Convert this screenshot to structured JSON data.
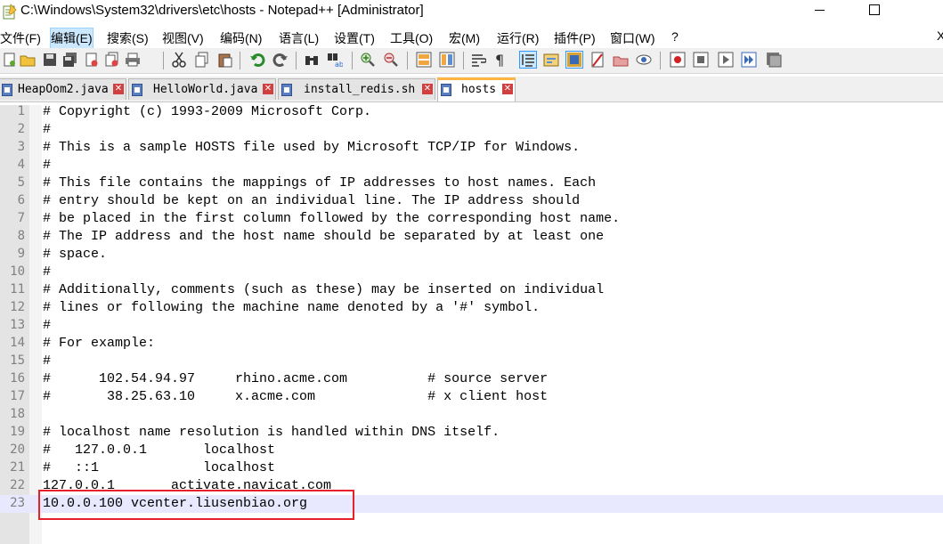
{
  "window": {
    "title": "C:\\Windows\\System32\\drivers\\etc\\hosts - Notepad++ [Administrator]"
  },
  "menu": [
    {
      "label": "文件(F)"
    },
    {
      "label": "编辑(E)",
      "active": true
    },
    {
      "label": "搜索(S)"
    },
    {
      "label": "视图(V)"
    },
    {
      "label": "编码(N)"
    },
    {
      "label": "语言(L)"
    },
    {
      "label": "设置(T)"
    },
    {
      "label": "工具(O)"
    },
    {
      "label": "宏(M)"
    },
    {
      "label": "运行(R)"
    },
    {
      "label": "插件(P)"
    },
    {
      "label": "窗口(W)"
    },
    {
      "label": "?"
    }
  ],
  "menu_close": "X",
  "toolbar_icons": [
    "new-file-icon",
    "open-file-icon",
    "save-icon",
    "save-all-icon",
    "close-icon",
    "close-all-icon",
    "print-icon",
    "cut-icon",
    "copy-icon",
    "paste-icon",
    "undo-icon",
    "redo-icon",
    "find-icon",
    "replace-icon",
    "zoom-in-icon",
    "zoom-out-icon",
    "sync-vertical-icon",
    "sync-horizontal-icon",
    "word-wrap-icon",
    "show-all-chars-icon",
    "indent-guide-icon",
    "user-language-icon",
    "function-list-icon",
    "folder-workspace-icon",
    "document-map-icon",
    "monitor-icon",
    "record-macro-icon",
    "stop-record-icon",
    "playback-macro-icon",
    "run-macro-multiple-icon",
    "save-macro-icon"
  ],
  "tabs": [
    {
      "label": "HeapOom2.java",
      "active": false
    },
    {
      "label": "HelloWorld.java",
      "active": false
    },
    {
      "label": "install_redis.sh",
      "active": false
    },
    {
      "label": "hosts",
      "active": true
    }
  ],
  "tab_close_glyph": "✕",
  "editor": {
    "lines": [
      {
        "n": "1",
        "text": "# Copyright (c) 1993-2009 Microsoft Corp."
      },
      {
        "n": "2",
        "text": "#"
      },
      {
        "n": "3",
        "text": "# This is a sample HOSTS file used by Microsoft TCP/IP for Windows."
      },
      {
        "n": "4",
        "text": "#"
      },
      {
        "n": "5",
        "text": "# This file contains the mappings of IP addresses to host names. Each"
      },
      {
        "n": "6",
        "text": "# entry should be kept on an individual line. The IP address should"
      },
      {
        "n": "7",
        "text": "# be placed in the first column followed by the corresponding host name."
      },
      {
        "n": "8",
        "text": "# The IP address and the host name should be separated by at least one"
      },
      {
        "n": "9",
        "text": "# space."
      },
      {
        "n": "10",
        "text": "#"
      },
      {
        "n": "11",
        "text": "# Additionally, comments (such as these) may be inserted on individual"
      },
      {
        "n": "12",
        "text": "# lines or following the machine name denoted by a '#' symbol."
      },
      {
        "n": "13",
        "text": "#"
      },
      {
        "n": "14",
        "text": "# For example:"
      },
      {
        "n": "15",
        "text": "#"
      },
      {
        "n": "16",
        "text": "#      102.54.94.97     rhino.acme.com          # source server"
      },
      {
        "n": "17",
        "text": "#       38.25.63.10     x.acme.com              # x client host"
      },
      {
        "n": "18",
        "text": ""
      },
      {
        "n": "19",
        "text": "# localhost name resolution is handled within DNS itself."
      },
      {
        "n": "20",
        "text": "#   127.0.0.1       localhost"
      },
      {
        "n": "21",
        "text": "#   ::1             localhost"
      },
      {
        "n": "22",
        "text": "127.0.0.1       activate.navicat.com"
      },
      {
        "n": "23",
        "text": "10.0.0.100 vcenter.liusenbiao.org",
        "current": true
      }
    ]
  }
}
